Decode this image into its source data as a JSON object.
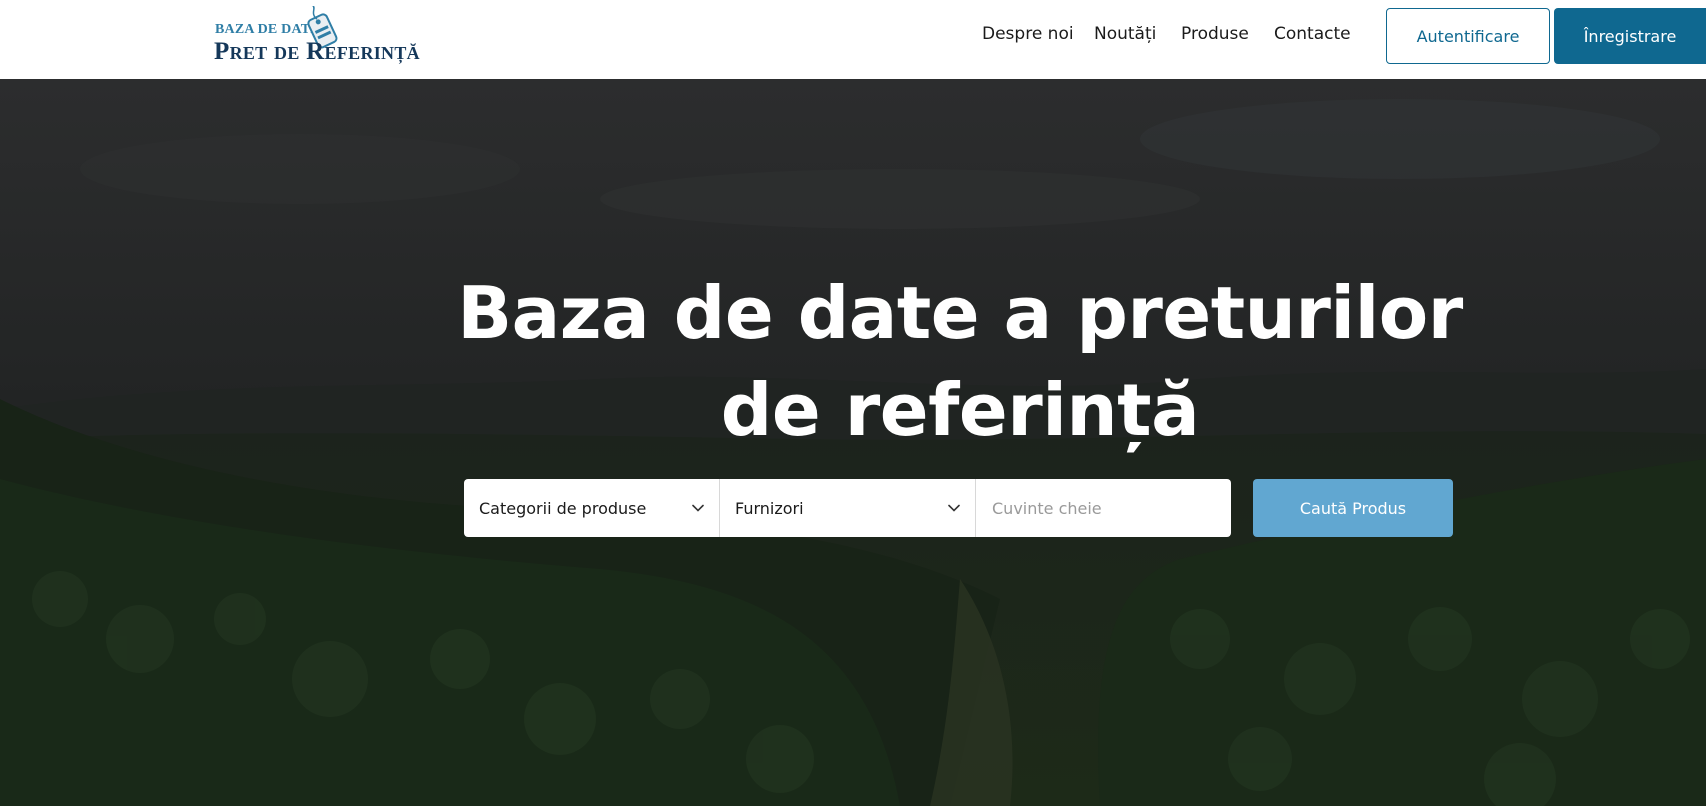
{
  "logo": {
    "line1": "BAZA DE DATE",
    "line2": "Pret de Referință",
    "icon": "price-tag-icon"
  },
  "nav": {
    "items": [
      {
        "label": "Despre noi"
      },
      {
        "label": "Noutăți"
      },
      {
        "label": "Produse"
      },
      {
        "label": "Contacte"
      }
    ],
    "login_label": "Autentificare",
    "register_label": "Înregistrare"
  },
  "hero": {
    "title_line1": "Baza de date a preturilor",
    "title_line2": "de referință"
  },
  "search": {
    "category_select": {
      "value": "Categorii de produse"
    },
    "supplier_select": {
      "value": "Furnizori"
    },
    "keywords": {
      "value": "",
      "placeholder": "Cuvinte cheie"
    },
    "submit_label": "Caută Produs",
    "chevron_icon": "chevron-down-icon"
  },
  "colors": {
    "brand_dark": "#0f6890",
    "brand_light": "#61a7d1",
    "logo_navy": "#15385a",
    "hero_overlay": "#1e211f"
  }
}
